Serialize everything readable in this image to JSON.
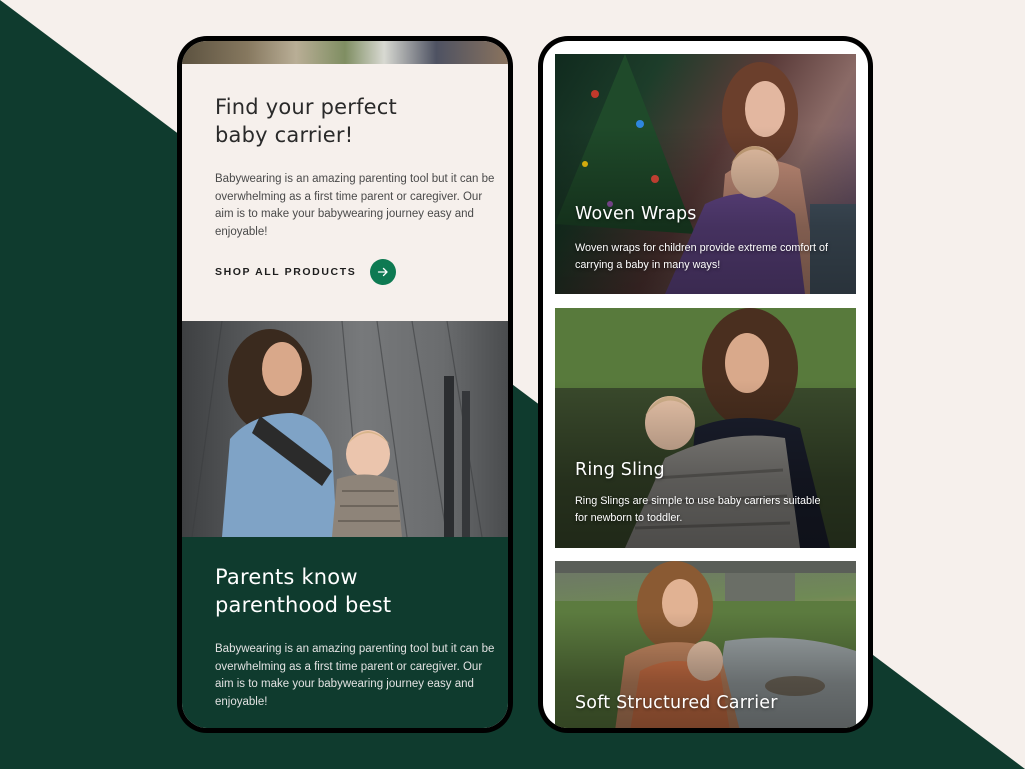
{
  "colors": {
    "background_cream": "#f6f0ec",
    "brand_dark_green": "#0f3b2e",
    "accent_green": "#0e7a52",
    "text_dark": "#2a2a2a"
  },
  "left_screen": {
    "hero": {
      "title_line1": "Find your perfect",
      "title_line2": "baby carrier!",
      "description": "Babywearing is an amazing parenting tool but it can be overwhelming as a first time parent or caregiver.  Our aim is to make your babywearing journey easy and enjoyable!",
      "cta_label": "SHOP ALL PRODUCTS",
      "cta_icon": "arrow-right-icon"
    },
    "parents_section": {
      "title_line1": "Parents know",
      "title_line2": "parenthood best",
      "description": "Babywearing is an amazing parenting tool but it can be overwhelming as a first time parent or caregiver.  Our aim is to make your babywearing journey easy and enjoyable!"
    }
  },
  "right_screen": {
    "categories": [
      {
        "title": "Woven Wraps",
        "description": "Woven wraps for children provide extreme comfort of carrying a baby in many ways!"
      },
      {
        "title": "Ring Sling",
        "description": "Ring Slings are simple to use baby carriers suitable for newborn to toddler."
      },
      {
        "title": "Soft Structured Carrier"
      }
    ]
  }
}
